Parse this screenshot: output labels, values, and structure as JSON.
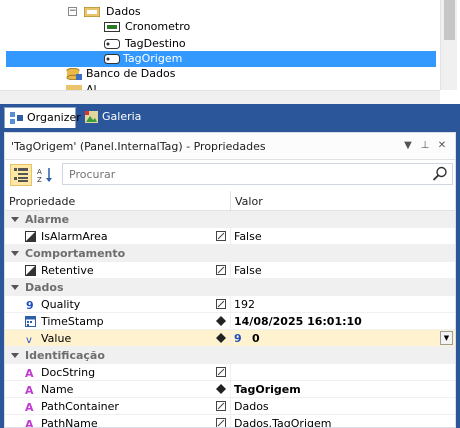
{
  "tree": {
    "items": [
      {
        "label": "Dados",
        "icon": "folder-db-icon"
      },
      {
        "label": "Cronometro",
        "icon": "timer-tag-icon"
      },
      {
        "label": "TagDestino",
        "icon": "internal-tag-icon"
      },
      {
        "label": "TagOrigem",
        "icon": "internal-tag-icon"
      },
      {
        "label": "Banco de Dados",
        "icon": "database-icon"
      },
      {
        "label": "Al...",
        "icon": "alarm-icon"
      }
    ]
  },
  "tabs": [
    {
      "label": "Organizer"
    },
    {
      "label": "Galeria"
    }
  ],
  "properties": {
    "title": "'TagOrigem' (Panel.InternalTag) - Propriedades",
    "search_placeholder": "Procurar",
    "col_name": "Propriedade",
    "col_value": "Valor",
    "categories": [
      {
        "name": "Alarme",
        "rows": [
          {
            "name": "IsAlarmArea",
            "value": "False"
          }
        ]
      },
      {
        "name": "Comportamento",
        "rows": [
          {
            "name": "Retentive",
            "value": "False"
          }
        ]
      },
      {
        "name": "Dados",
        "rows": [
          {
            "name": "Quality",
            "value": "192"
          },
          {
            "name": "TimeStamp",
            "value": "14/08/2025 16:01:10"
          },
          {
            "name": "Value",
            "value": "0"
          }
        ]
      },
      {
        "name": "Identificação",
        "rows": [
          {
            "name": "DocString",
            "value": ""
          },
          {
            "name": "Name",
            "value": "TagOrigem"
          },
          {
            "name": "PathContainer",
            "value": "Dados"
          },
          {
            "name": "PathName",
            "value": "Dados.TagOrigem"
          }
        ]
      }
    ],
    "value_type_glyph": "9"
  },
  "colors": {
    "selection": "#3399ff",
    "chrome": "#2b579a",
    "row_highlight": "#fff3cf"
  }
}
